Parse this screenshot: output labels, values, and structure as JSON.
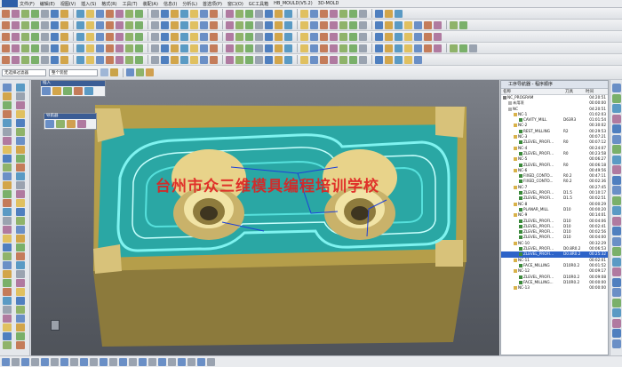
{
  "menu": {
    "items": [
      "文件(F)",
      "编辑(E)",
      "视图(V)",
      "插入(S)",
      "格式(R)",
      "工具(T)",
      "装配(A)",
      "信息(I)",
      "分析(L)",
      "首选项(P)",
      "窗口(O)",
      "GC工具箱",
      "HB_MOULD(V5.2)",
      "3D-MOLD"
    ]
  },
  "toolbar": {
    "selection_filter": "无选择过滤器",
    "scope": "整个装配"
  },
  "palettes": {
    "insert_title": "插入",
    "nav_title": "导航器"
  },
  "watermark": "台州市众三维模具编程培训学校",
  "navigator": {
    "title": "工序导航器 - 程序顺序",
    "columns": {
      "name": "名称",
      "tool": "刀具",
      "time": "时间"
    },
    "rows": [
      {
        "name": "NC_PROGRAM",
        "tool": "",
        "time": "04:20:51",
        "level": 0
      },
      {
        "name": "未用项",
        "tool": "",
        "time": "00:00:00",
        "level": 1
      },
      {
        "name": "NC",
        "tool": "",
        "time": "04:20:51",
        "level": 1
      },
      {
        "name": "NC-1",
        "tool": "",
        "time": "01:02:03",
        "level": 2
      },
      {
        "name": "CAVITY_MILL",
        "tool": "D63R3",
        "time": "01:01:54",
        "level": 3
      },
      {
        "name": "NC-2",
        "tool": "",
        "time": "00:30:02",
        "level": 2
      },
      {
        "name": "REST_MILLING",
        "tool": "R2",
        "time": "00:29:53",
        "level": 3
      },
      {
        "name": "NC-3",
        "tool": "",
        "time": "00:07:21",
        "level": 2
      },
      {
        "name": "ZLEVEL_PROFI...",
        "tool": "R0",
        "time": "00:07:12",
        "level": 3
      },
      {
        "name": "NC-4",
        "tool": "",
        "time": "00:24:07",
        "level": 2
      },
      {
        "name": "ZLEVEL_PROFI...",
        "tool": "R0",
        "time": "00:23:58",
        "level": 3
      },
      {
        "name": "NC-5",
        "tool": "",
        "time": "00:06:27",
        "level": 2
      },
      {
        "name": "ZLEVEL_PROFI...",
        "tool": "R0",
        "time": "00:06:18",
        "level": 3
      },
      {
        "name": "NC-6",
        "tool": "",
        "time": "00:49:56",
        "level": 2
      },
      {
        "name": "FIXED_CONTO...",
        "tool": "R0.2",
        "time": "00:47:11",
        "level": 3
      },
      {
        "name": "FIXED_CONTO...",
        "tool": "R0.2",
        "time": "00:02:36",
        "level": 3
      },
      {
        "name": "NC-7",
        "tool": "",
        "time": "00:27:45",
        "level": 2
      },
      {
        "name": "ZLEVEL_PROFI...",
        "tool": "D1.5",
        "time": "00:10:17",
        "level": 3
      },
      {
        "name": "ZLEVEL_PROFI...",
        "tool": "D1.5",
        "time": "00:02:51",
        "level": 3
      },
      {
        "name": "NC-8",
        "tool": "",
        "time": "00:00:29",
        "level": 2
      },
      {
        "name": "PLANAR_MILL",
        "tool": "D10",
        "time": "00:00:20",
        "level": 3
      },
      {
        "name": "NC-9",
        "tool": "",
        "time": "00:14:01",
        "level": 2
      },
      {
        "name": "ZLEVEL_PROFI...",
        "tool": "D10",
        "time": "00:04:06",
        "level": 3
      },
      {
        "name": "ZLEVEL_PROFI...",
        "tool": "D10",
        "time": "00:02:41",
        "level": 3
      },
      {
        "name": "ZLEVEL_PROFI...",
        "tool": "D10",
        "time": "00:02:56",
        "level": 3
      },
      {
        "name": "ZLEVEL_PROFI...",
        "tool": "D10",
        "time": "00:04:00",
        "level": 3
      },
      {
        "name": "NC-10",
        "tool": "",
        "time": "00:32:29",
        "level": 2
      },
      {
        "name": "ZLEVEL_PROFI...",
        "tool": "D0.8R0.2",
        "time": "00:06:53",
        "level": 3
      },
      {
        "name": "ZLEVEL_PROFI...",
        "tool": "D0.8R0.2",
        "time": "00:25:32",
        "level": 3,
        "selected": true
      },
      {
        "name": "NC-11",
        "tool": "",
        "time": "00:02:01",
        "level": 2
      },
      {
        "name": "FACE_MILLING",
        "tool": "D10R0.2",
        "time": "00:01:52",
        "level": 3
      },
      {
        "name": "NC-12",
        "tool": "",
        "time": "00:09:17",
        "level": 2
      },
      {
        "name": "ZLEVEL_PROFI...",
        "tool": "D10R0.2",
        "time": "00:09:08",
        "level": 3
      },
      {
        "name": "FACE_MILLING...",
        "tool": "D10R0.2",
        "time": "00:00:00",
        "level": 3
      },
      {
        "name": "NC-13",
        "tool": "",
        "time": "00:00:00",
        "level": 2
      }
    ]
  }
}
